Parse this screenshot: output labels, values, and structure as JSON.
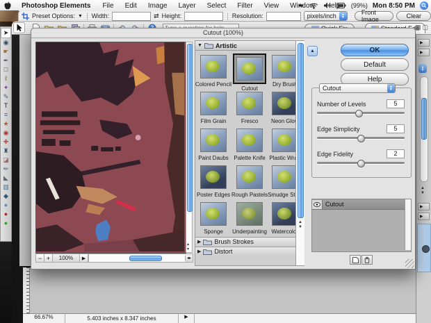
{
  "menu_bar": {
    "app_name": "Photoshop Elements",
    "menus": [
      "File",
      "Edit",
      "Image",
      "Layer",
      "Select",
      "Filter",
      "View",
      "Window",
      "Help"
    ],
    "battery_label": "(99%)",
    "clock": "Mon 8:50 PM"
  },
  "options_bar": {
    "preset_options": "Preset Options:",
    "width": "Width:",
    "height": "Height:",
    "resolution": "Resolution:",
    "units": "pixels/inch",
    "front_image": "Front Image",
    "clear": "Clear"
  },
  "shortcuts_bar": {
    "search_placeholder": "Type a question for help",
    "quick_fix": "Quick Fix",
    "standard_edit": "Standard Edit"
  },
  "toolbox": {
    "tools": [
      {
        "name": "move-tool",
        "glyph": "➤",
        "color": "#1a1a1a"
      },
      {
        "name": "zoom-tool",
        "glyph": "◉",
        "color": "#2a4a6a"
      },
      {
        "name": "hand-tool",
        "glyph": "☛",
        "color": "#a07040"
      },
      {
        "name": "eyedropper-tool",
        "glyph": "✒",
        "color": "#4a5a6a"
      },
      {
        "name": "marquee-tool",
        "glyph": "□",
        "color": "#33445a"
      },
      {
        "name": "lasso-tool",
        "glyph": "ℓ",
        "color": "#7a5a3a"
      },
      {
        "name": "magic-wand-tool",
        "glyph": "✦",
        "color": "#7a4aa0"
      },
      {
        "name": "selection-brush-tool",
        "glyph": "✎",
        "color": "#4a5a7a"
      },
      {
        "name": "type-tool",
        "glyph": "T",
        "color": "#222233"
      },
      {
        "name": "crop-tool",
        "glyph": "⌗",
        "color": "#2a4a7a"
      },
      {
        "name": "cookie-cutter-tool",
        "glyph": "★",
        "color": "#b05a2a"
      },
      {
        "name": "red-eye-tool",
        "glyph": "◉",
        "color": "#b03030"
      },
      {
        "name": "healing-brush-tool",
        "glyph": "✚",
        "color": "#b05050"
      },
      {
        "name": "clone-stamp-tool",
        "glyph": "♜",
        "color": "#3a4a6a"
      },
      {
        "name": "eraser-tool",
        "glyph": "◪",
        "color": "#a06868"
      },
      {
        "name": "brush-tool",
        "glyph": "✏",
        "color": "#4a5a7a"
      },
      {
        "name": "paint-bucket-tool",
        "glyph": "◣",
        "color": "#5a6a7a"
      },
      {
        "name": "gradient-tool",
        "glyph": "▥",
        "color": "#4a7090"
      },
      {
        "name": "shape-tool",
        "glyph": "◆",
        "color": "#2a5a7a"
      },
      {
        "name": "blur-tool",
        "glyph": "●",
        "color": "#6a88a8"
      },
      {
        "name": "foreground-color-swatch",
        "glyph": "●",
        "color": "#bb2222"
      },
      {
        "name": "background-color-swatch",
        "glyph": "●",
        "color": "#22aa22"
      }
    ]
  },
  "dialog": {
    "title": "Cutout (100%)",
    "preview_zoom": "100%",
    "buttons": {
      "ok": "OK",
      "default": "Default",
      "help": "Help"
    },
    "filter_popup": "Cutout",
    "sliders": [
      {
        "label": "Number of Levels",
        "value": "5",
        "pct": 48
      },
      {
        "label": "Edge Simplicity",
        "value": "5",
        "pct": 50
      },
      {
        "label": "Edge Fidelity",
        "value": "2",
        "pct": 50
      }
    ],
    "category": "Artistic",
    "filters": [
      {
        "name": "Colored Pencil"
      },
      {
        "name": "Cutout",
        "selected": true
      },
      {
        "name": "Dry Brush"
      },
      {
        "name": "Film Grain"
      },
      {
        "name": "Fresco"
      },
      {
        "name": "Neon Glow",
        "variant": "dark"
      },
      {
        "name": "Paint Daubs"
      },
      {
        "name": "Palette Knife"
      },
      {
        "name": "Plastic Wrap"
      },
      {
        "name": "Poster Edges",
        "variant": "dark"
      },
      {
        "name": "Rough Pastels"
      },
      {
        "name": "Smudge Stick"
      },
      {
        "name": "Sponge"
      },
      {
        "name": "Underpainting",
        "variant": "muted"
      },
      {
        "name": "Watercolor",
        "variant": "dark"
      }
    ],
    "collapsed_categories": [
      "Brush Strokes",
      "Distort"
    ],
    "effect_layers": [
      "Cutout"
    ]
  },
  "status_bar": {
    "zoom": "66.67%",
    "dimensions": "5.403 inches x 8.347 inches"
  }
}
